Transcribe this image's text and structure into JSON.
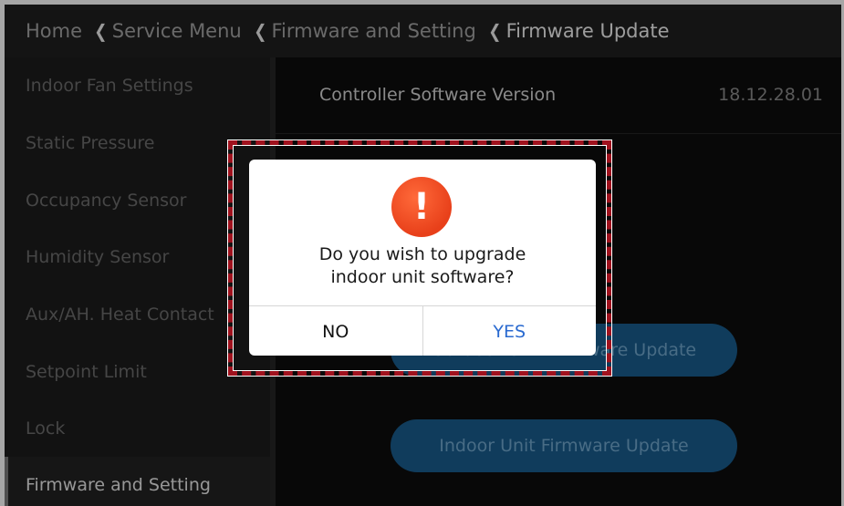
{
  "breadcrumb": {
    "home": "Home",
    "service_menu": "Service Menu",
    "firmware_setting": "Firmware and Setting",
    "current": "Firmware Update",
    "separator_icon": "chevron-left-icon"
  },
  "sidebar": {
    "items": [
      {
        "label": "Indoor Fan Settings"
      },
      {
        "label": "Static Pressure"
      },
      {
        "label": "Occupancy Sensor"
      },
      {
        "label": "Humidity Sensor"
      },
      {
        "label": "Aux/AH. Heat Contact"
      },
      {
        "label": "Setpoint Limit"
      },
      {
        "label": "Lock"
      },
      {
        "label": "Firmware and Setting"
      }
    ],
    "active_index": 7
  },
  "main": {
    "version_label": "Controller Software Version",
    "version_value": "18.12.28.01",
    "button_1": "Outdoor Unit Firmware Update",
    "button_2": "Indoor Unit Firmware Update"
  },
  "dialog": {
    "icon": "exclamation-alert-icon",
    "message_line1": "Do you wish to upgrade",
    "message_line2": "indoor unit software?",
    "no_label": "NO",
    "yes_label": "YES"
  },
  "colors": {
    "alert": "#e8401a",
    "yes": "#2a6ad0",
    "highlight": "#a0121e",
    "pill": "#1a5c8e"
  }
}
